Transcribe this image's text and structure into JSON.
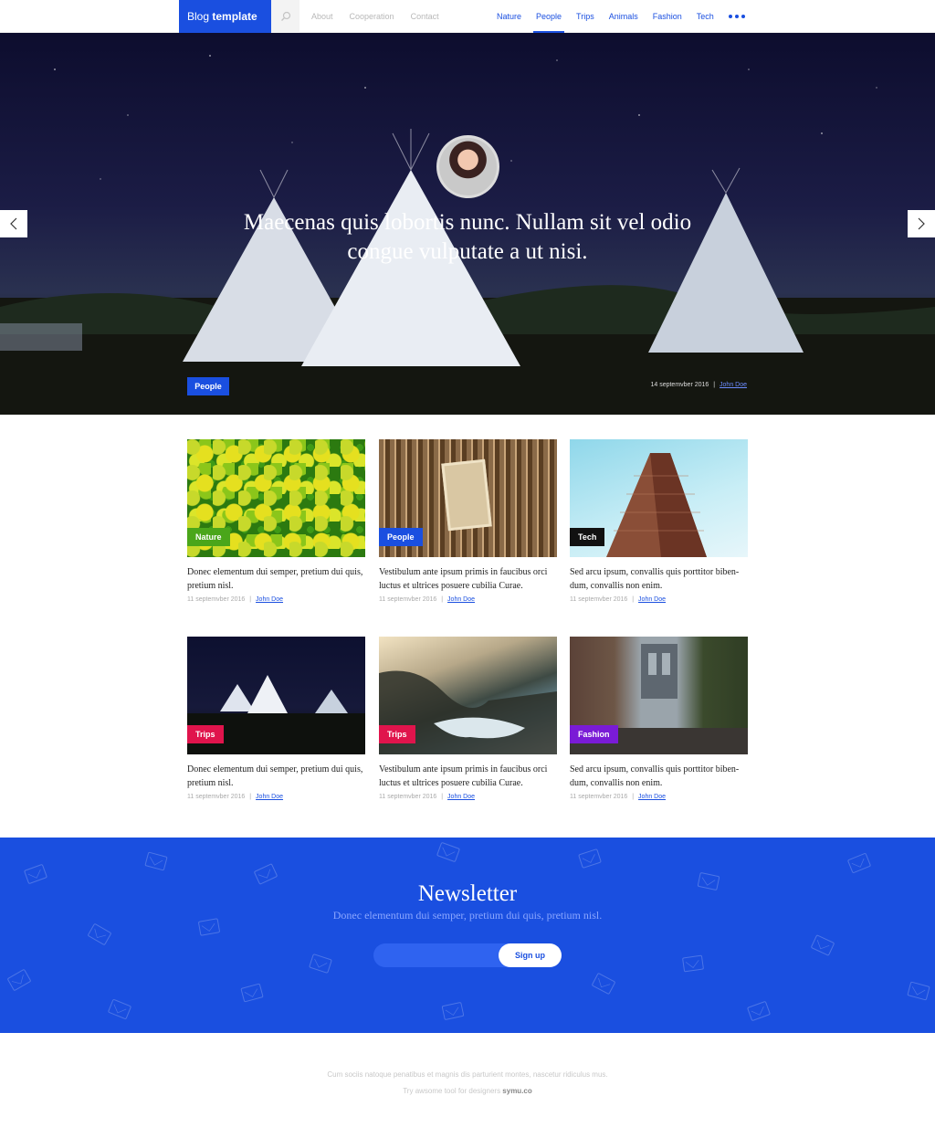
{
  "header": {
    "brand_light": "Blog ",
    "brand_bold": "template",
    "nav_left": [
      "About",
      "Cooperation",
      "Contact"
    ],
    "nav_right": [
      "Nature",
      "People",
      "Trips",
      "Animals",
      "Fashion",
      "Tech"
    ],
    "active": "People"
  },
  "hero": {
    "quote": "Maecenas quis lobortis nunc. Nullam sit vel odio congue vulputate a ut nisi.",
    "tag": "People",
    "date": "14 septemvber 2016",
    "separator": "|",
    "author": "John Doe"
  },
  "posts": [
    {
      "tag": "Nature",
      "tag_color": "#4aa61a",
      "title": "Donec elementum dui semper, pretium dui quis, pretium nisl.",
      "date": "11 septemvber 2016",
      "author": "John Doe"
    },
    {
      "tag": "People",
      "tag_color": "#1a4fe0",
      "title": "Vestibulum ante ipsum primis in faucibus orci luctus et ultrices posuere cubilia Curae.",
      "date": "11 septemvber 2016",
      "author": "John Doe"
    },
    {
      "tag": "Tech",
      "tag_color": "#111111",
      "title": "Sed arcu ipsum, convallis quis porttitor biben-dum, convallis non enim.",
      "date": "11 septemvber 2016",
      "author": "John Doe"
    },
    {
      "tag": "Trips",
      "tag_color": "#e0144c",
      "title": "Donec elementum dui semper, pretium dui quis, pretium nisl.",
      "date": "11 septemvber 2016",
      "author": "John Doe"
    },
    {
      "tag": "Trips",
      "tag_color": "#e0144c",
      "title": "Vestibulum ante ipsum primis in faucibus orci luctus et ultrices posuere cubilia Curae.",
      "date": "11 septemvber 2016",
      "author": "John Doe"
    },
    {
      "tag": "Fashion",
      "tag_color": "#7a1bd6",
      "title": "Sed arcu ipsum, convallis quis porttitor biben-dum, convallis non enim.",
      "date": "11 septemvber 2016",
      "author": "John Doe"
    }
  ],
  "newsletter": {
    "title": "Newsletter",
    "subtitle": "Donec elementum dui semper, pretium dui quis, pretium nisl.",
    "input_placeholder": "",
    "button": "Sign up"
  },
  "footer": {
    "line1": "Cum sociis natoque penatibus et magnis dis parturient montes, nascetur ridiculus mus.",
    "line2_prefix": "Try awsome tool for designers ",
    "line2_link": "symu.co"
  },
  "colors": {
    "accent": "#1a4fe0"
  }
}
